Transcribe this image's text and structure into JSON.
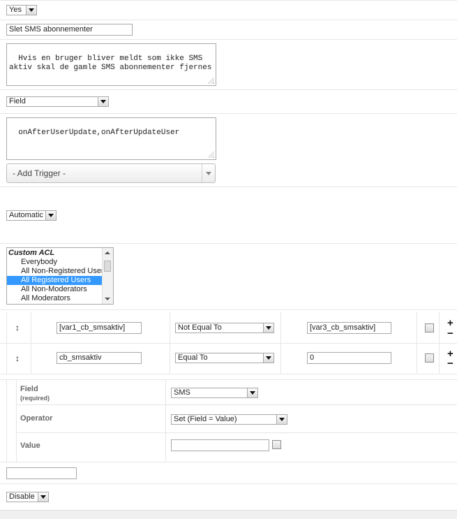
{
  "published": {
    "value": "Yes"
  },
  "title_input": {
    "value": "Slet SMS abonnementer"
  },
  "description": {
    "value": "Hvis en bruger bliver meldt som ikke SMS aktiv skal de gamle SMS abonnementer fjernes"
  },
  "trigger_type": {
    "value": "Field"
  },
  "triggers_text": {
    "value": "onAfterUserUpdate,onAfterUpdateUser"
  },
  "add_trigger": {
    "label": "- Add Trigger -"
  },
  "mode": {
    "value": "Automatic"
  },
  "acl": {
    "group_label": "Custom ACL",
    "options": [
      "Everybody",
      "All Non-Registered Users",
      "All Registered Users",
      "All Non-Moderators",
      "All Moderators"
    ],
    "selected": "All Registered Users"
  },
  "conditions": [
    {
      "move_icon": "↕",
      "field": "[var1_cb_smsaktiv]",
      "operator": "Not Equal To",
      "value": "[var3_cb_smsaktiv]"
    },
    {
      "move_icon": "↕",
      "field": "cb_smsaktiv",
      "operator": "Equal To",
      "value": "0"
    }
  ],
  "action": {
    "field_label": "Field",
    "field_required": "(required)",
    "field_value": "SMS",
    "operator_label": "Operator",
    "operator_value": "Set (Field = Value)",
    "value_label": "Value",
    "value_value": ""
  },
  "extra_input": {
    "value": ""
  },
  "status": {
    "value": "Disable"
  },
  "icons": {
    "plus": "+",
    "minus": "−"
  }
}
